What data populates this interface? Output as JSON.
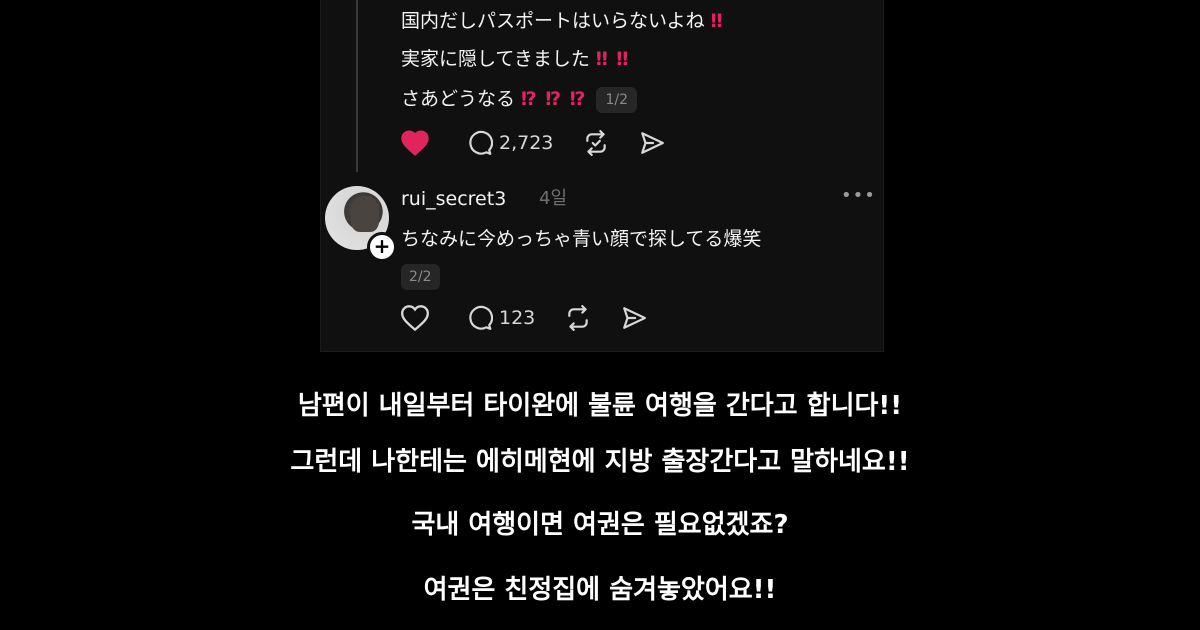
{
  "thread": {
    "lines": [
      {
        "text": "国内だしパスポートはいらないよね",
        "mark": "‼"
      },
      {
        "text": "実家に隠してきました",
        "mark": "‼ ‼"
      },
      {
        "text": "さあどうなる",
        "mark": "⁉ ⁉ ⁉",
        "badge": "1/2"
      }
    ],
    "liked": true,
    "like_color": "#e0245e",
    "reply_count": "2,723"
  },
  "reply": {
    "username": "rui_secret3",
    "time": "4일",
    "more_label": "•••",
    "follow_label": "+",
    "text": "ちなみに今めっちゃ青い顔で探してる爆笑",
    "badge": "2/2",
    "reply_count": "123"
  },
  "captions": [
    "남편이 내일부터 타이완에 불륜 여행을 간다고 합니다!!",
    "그런데 나한테는 에히메현에 지방 출장간다고 말하네요!!",
    "국내 여행이면 여권은 필요없겠죠?",
    "여권은 친정집에 숨겨놓았어요!!"
  ],
  "icons": [
    "heart-icon",
    "comment-icon",
    "repost-icon",
    "share-icon",
    "more-icon",
    "plus-icon"
  ]
}
